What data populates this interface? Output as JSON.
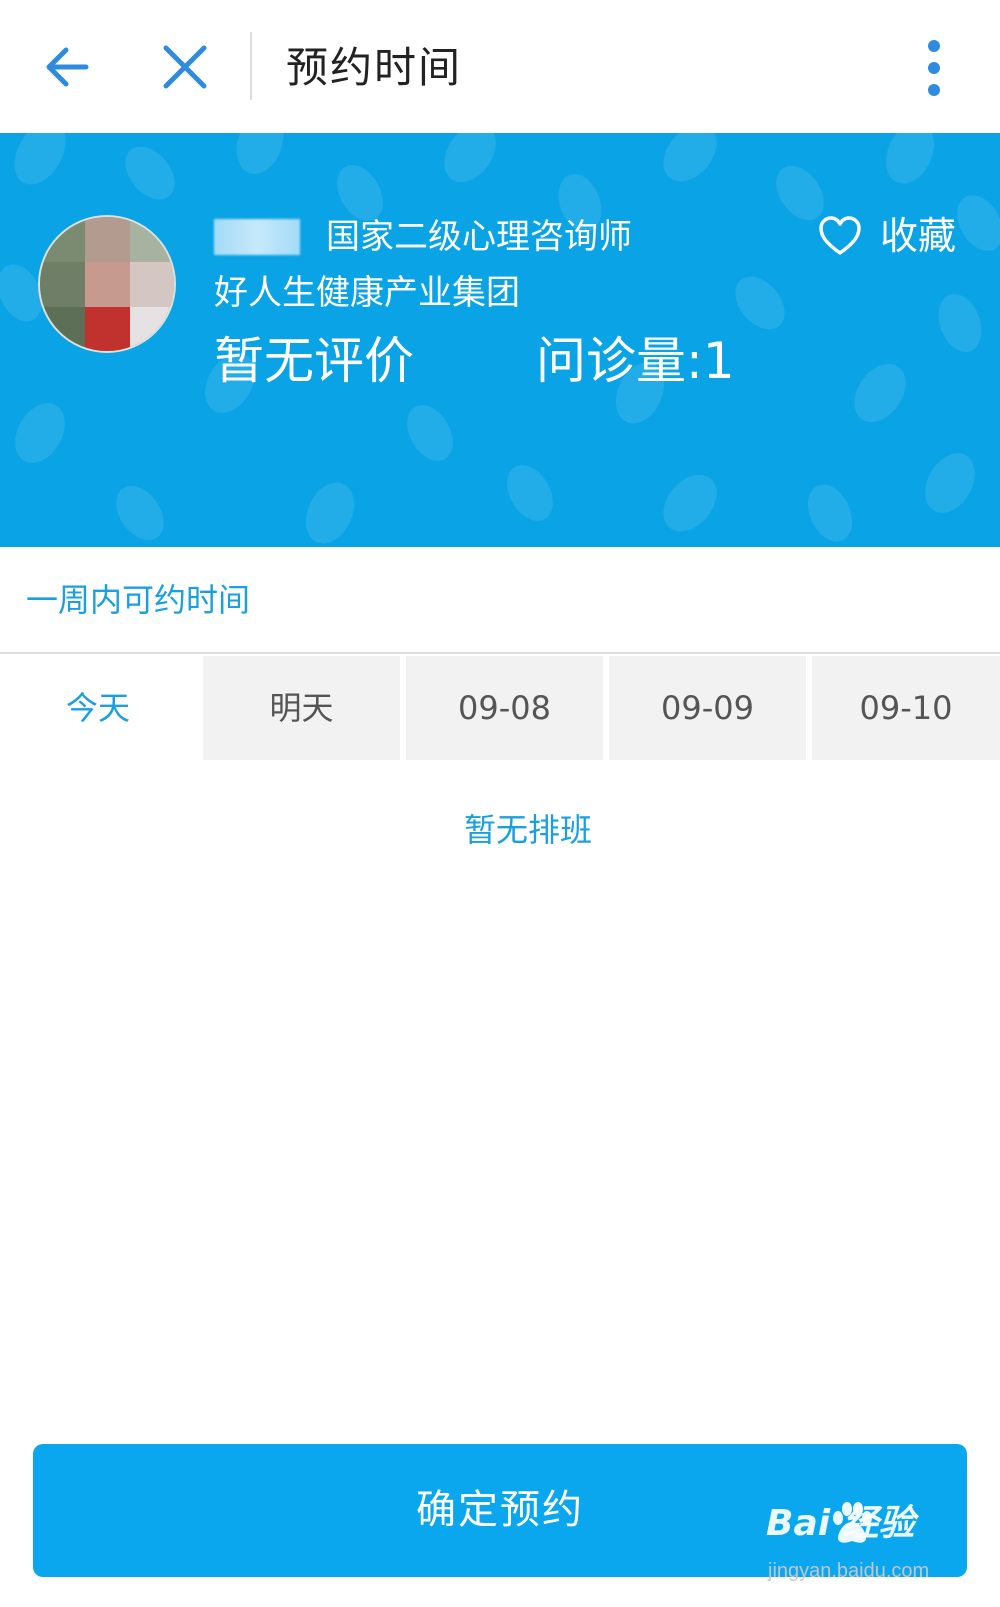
{
  "navbar": {
    "title": "预约时间",
    "back_icon": "back-arrow-icon",
    "close_icon": "close-icon",
    "more_icon": "more-vertical-icon"
  },
  "doctor": {
    "title": "国家二级心理咨询师",
    "organization": "好人生健康产业集团",
    "rating_text": "暂无评价",
    "consult_text": "问诊量:1",
    "favorite_label": "收藏",
    "favorite_icon": "heart-outline-icon"
  },
  "schedule": {
    "header": "一周内可约时间",
    "days": [
      {
        "label": "今天",
        "active": true
      },
      {
        "label": "明天",
        "active": false
      },
      {
        "label": "09-08",
        "active": false
      },
      {
        "label": "09-09",
        "active": false
      },
      {
        "label": "09-10",
        "active": false
      }
    ],
    "empty_text": "暂无排班"
  },
  "confirm": {
    "label": "确定预约"
  },
  "watermark": {
    "logo": "Bai  经验",
    "url": "jingyan.baidu.com"
  },
  "colors": {
    "accent": "#0aa3e6",
    "accent_text": "#1a9fe0",
    "nav_icon": "#2f8be0",
    "tab_bg": "#f2f2f2"
  }
}
